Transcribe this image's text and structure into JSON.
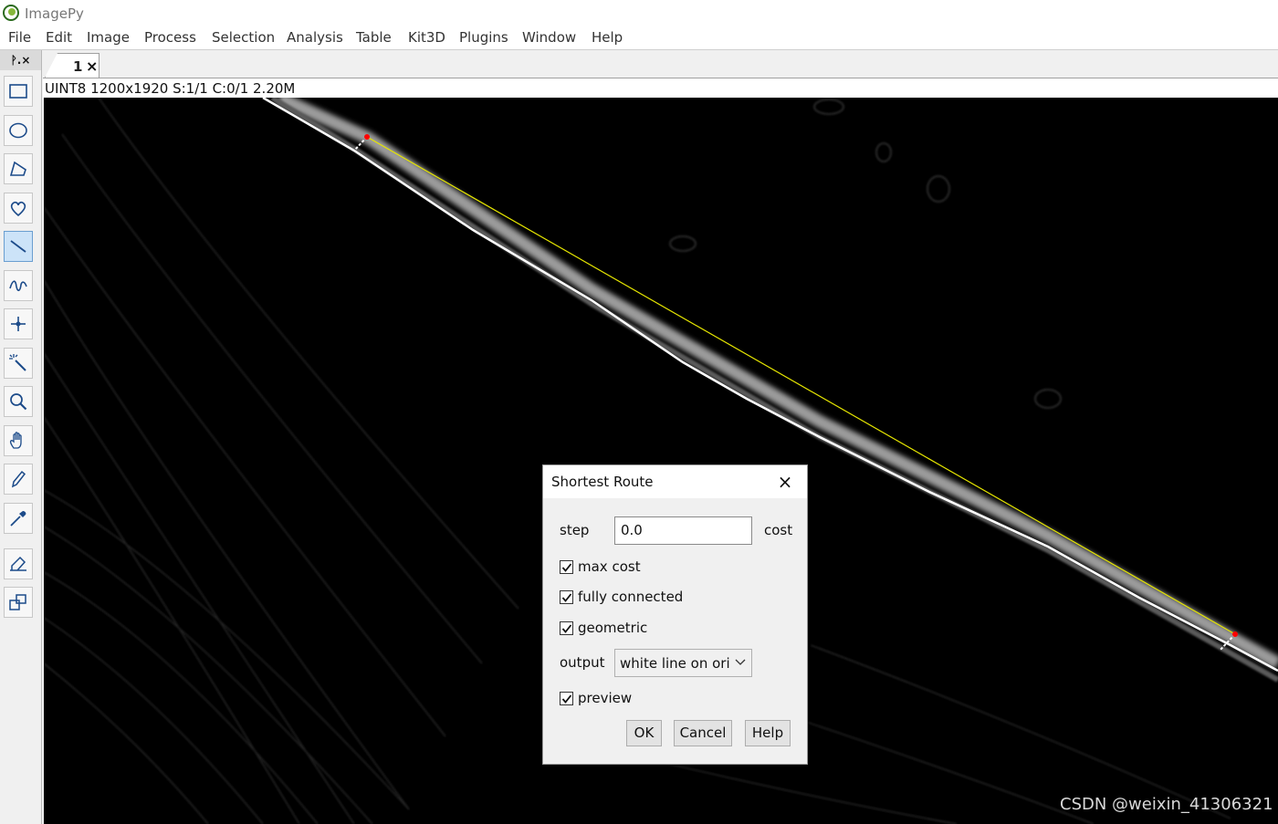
{
  "app": {
    "title": "ImagePy"
  },
  "menu": [
    "File",
    "Edit",
    "Image",
    "Process",
    "Selection",
    "Analysis",
    "Table",
    "Kit3D",
    "Plugins",
    "Window",
    "Help"
  ],
  "panel": {
    "header": "ᚹ.×"
  },
  "tools": [
    {
      "name": "rectangle-tool",
      "icon": "rectangle-icon",
      "active": false
    },
    {
      "name": "ellipse-tool",
      "icon": "ellipse-icon",
      "active": false
    },
    {
      "name": "polygon-tool",
      "icon": "polygon-icon",
      "active": false
    },
    {
      "name": "freehand-tool",
      "icon": "freehand-icon",
      "active": false
    },
    {
      "name": "line-tool",
      "icon": "line-icon",
      "active": true
    },
    {
      "name": "polyline-tool",
      "icon": "polyline-icon",
      "active": false
    },
    {
      "name": "point-tool",
      "icon": "point-icon",
      "active": false
    },
    {
      "name": "magic-wand-tool",
      "icon": "magic-wand-icon",
      "active": false
    },
    {
      "name": "zoom-tool",
      "icon": "magnifier-icon",
      "active": false
    },
    {
      "name": "pan-tool",
      "icon": "hand-icon",
      "active": false
    },
    {
      "name": "pencil-tool",
      "icon": "pencil-icon",
      "active": false
    },
    {
      "name": "color-picker-tool",
      "icon": "dropper-icon",
      "active": false
    },
    {
      "name": "eraser-tool",
      "icon": "eraser-icon",
      "active": false
    },
    {
      "name": "crop-tool",
      "icon": "crop-icon",
      "active": false
    }
  ],
  "tab": {
    "label": "1",
    "close": "×"
  },
  "image_info": "UINT8  1200x1920  S:1/1  C:0/1  2.20M",
  "watermark": "CSDN @weixin_41306321",
  "colors": {
    "path_line": "#ffffff",
    "straight_line": "#e6e600",
    "endpoint": "#ff0000"
  },
  "dialog": {
    "title": "Shortest Route",
    "close": "×",
    "step_label": "step",
    "step_value": "0.0",
    "cost_label": "cost",
    "checkboxes": [
      {
        "label": "max cost",
        "checked": true
      },
      {
        "label": "fully connected",
        "checked": true
      },
      {
        "label": "geometric",
        "checked": true
      }
    ],
    "output_label": "output",
    "output_value": "white line on ori",
    "preview": {
      "label": "preview",
      "checked": true
    },
    "buttons": {
      "ok": "OK",
      "cancel": "Cancel",
      "help": "Help"
    }
  }
}
